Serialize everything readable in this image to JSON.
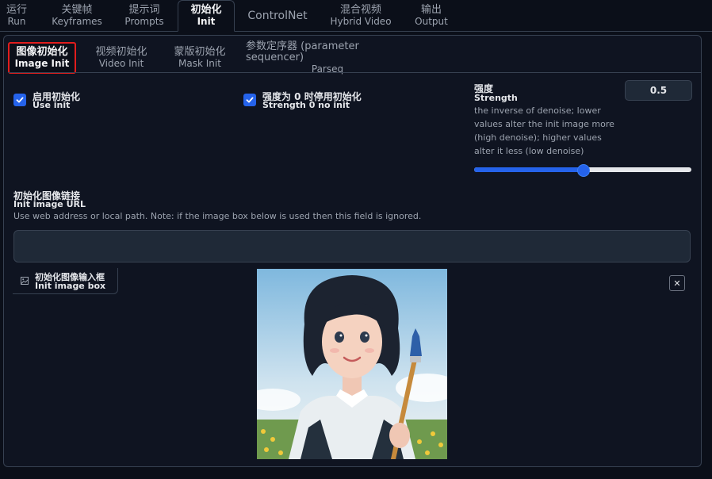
{
  "top_tabs": [
    {
      "zh": "运行",
      "en": "Run"
    },
    {
      "zh": "关键帧",
      "en": "Keyframes"
    },
    {
      "zh": "提示词",
      "en": "Prompts"
    },
    {
      "zh": "初始化",
      "en": "Init"
    },
    {
      "label": "ControlNet"
    },
    {
      "zh": "混合视频",
      "en": "Hybrid Video"
    },
    {
      "zh": "输出",
      "en": "Output"
    }
  ],
  "sub_tabs": [
    {
      "zh": "图像初始化",
      "en": "Image Init"
    },
    {
      "zh": "视频初始化",
      "en": "Video Init"
    },
    {
      "zh": "蒙版初始化",
      "en": "Mask Init"
    },
    {
      "zh": "参数定序器 (parameter sequencer)",
      "en": "Parseq"
    }
  ],
  "use_init": {
    "zh": "启用初始化",
    "en": "Use init",
    "checked": true
  },
  "strength_zero": {
    "zh": "强度为 0 时停用初始化",
    "en": "Strength 0 no init",
    "checked": true
  },
  "strength": {
    "zh": "强度",
    "en": "Strength",
    "desc": "the inverse of denoise; lower values alter the init image more (high denoise); higher values alter it less (low denoise)",
    "value": "0.5",
    "fraction": 0.5
  },
  "init_url": {
    "zh": "初始化图像链接",
    "en": "Init image URL",
    "desc": "Use web address or local path. Note: if the image box below is used then this field is ignored.",
    "value": ""
  },
  "init_box": {
    "zh": "初始化图像输入框",
    "en": "Init image box"
  },
  "colors": {
    "accent": "#2563eb",
    "highlight": "#e11d1d",
    "background": "#0b0f19"
  }
}
